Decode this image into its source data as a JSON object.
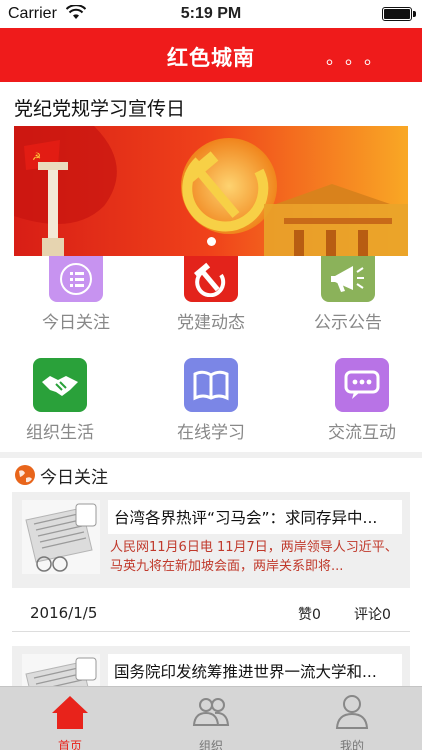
{
  "status_bar": {
    "carrier": "Carrier",
    "time": "5:19 PM"
  },
  "nav": {
    "title": "红色城南",
    "more": "。。。"
  },
  "banner": {
    "title": "党纪党规学习宣传日"
  },
  "grid": [
    {
      "label": "今日关注",
      "icon": "list-icon",
      "color": "#c793f0"
    },
    {
      "label": "党建动态",
      "icon": "hammer-sickle-icon",
      "color": "#e3231b"
    },
    {
      "label": "公示公告",
      "icon": "megaphone-icon",
      "color": "#8bb25a"
    },
    {
      "label": "组织生活",
      "icon": "handshake-icon",
      "color": "#2aa13a"
    },
    {
      "label": "在线学习",
      "icon": "book-icon",
      "color": "#7b86e6"
    },
    {
      "label": "交流互动",
      "icon": "chat-bubble-icon",
      "color": "#b873e6"
    }
  ],
  "section": {
    "label": "今日关注",
    "icon": "globe-icon"
  },
  "news": [
    {
      "title": "台湾各界热评“习马会”：求同存异中...",
      "summary": "人民网11月6日电 11月7日，两岸领导人习近平、马英九将在新加坡会面，两岸关系即将...",
      "date": "2016/1/5",
      "likes": "赞0",
      "comments": "评论0"
    },
    {
      "title": "国务院印发统筹推进世界一流大学和..."
    }
  ],
  "tabs": [
    {
      "label": "首页",
      "icon": "home-icon",
      "active": true
    },
    {
      "label": "组织",
      "icon": "people-icon",
      "active": false
    },
    {
      "label": "我的",
      "icon": "person-icon",
      "active": false
    }
  ],
  "colors": {
    "brand_red": "#ef1b1b",
    "summary_text": "#c0392b",
    "tab_active": "#e8231b"
  }
}
